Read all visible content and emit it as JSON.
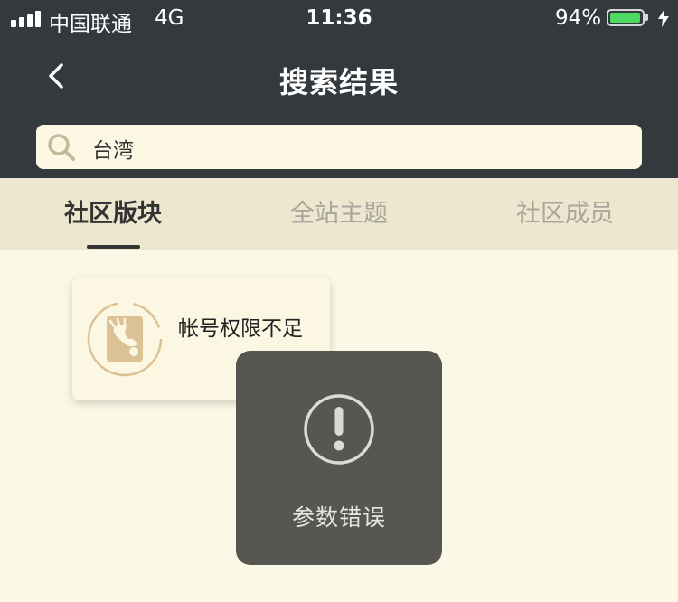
{
  "status_bar": {
    "carrier": "中国联通",
    "network": "4G",
    "time": "11:36",
    "battery_percent": "94%"
  },
  "navbar": {
    "title": "搜索结果",
    "back_icon": "chevron-left-icon"
  },
  "search": {
    "value": "台湾",
    "icon": "search-icon"
  },
  "tabs": [
    {
      "label": "社区版块",
      "active": true
    },
    {
      "label": "全站主题",
      "active": false
    },
    {
      "label": "社区成员",
      "active": false
    }
  ],
  "result_card": {
    "text": "帐号权限不足",
    "icon": "forum-logo-icon"
  },
  "toast": {
    "text": "参数错误",
    "icon": "exclamation-circle-icon"
  },
  "colors": {
    "header_bg": "#33393d",
    "page_bg": "#fcf8e6",
    "tab_bar_bg": "#ede7cf",
    "accent": "#dcc195",
    "battery_green": "#4cd964"
  }
}
